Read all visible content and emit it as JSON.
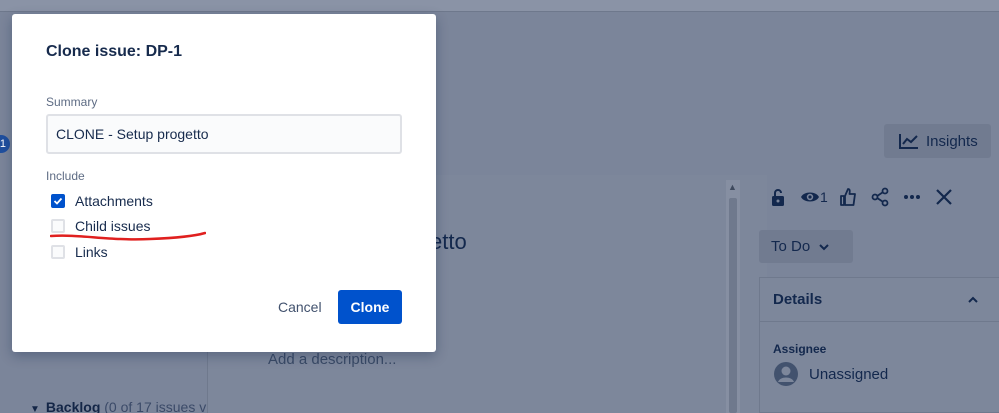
{
  "background": {
    "badge_count": "1",
    "issue_title_fragment": "etto",
    "description_placeholder": "Add a description...",
    "backlog_label": "Backlog",
    "backlog_count": "(0 of 17 issues v",
    "insights_label": "Insights",
    "watch_count": "1",
    "status_label": "To Do",
    "details_label": "Details",
    "assignee_label": "Assignee",
    "assignee_value": "Unassigned"
  },
  "modal": {
    "title": "Clone issue: DP-1",
    "summary_label": "Summary",
    "summary_value": "CLONE - Setup progetto",
    "include_label": "Include",
    "options": [
      {
        "label": "Attachments",
        "checked": true
      },
      {
        "label": "Child issues",
        "checked": false
      },
      {
        "label": "Links",
        "checked": false
      }
    ],
    "cancel_label": "Cancel",
    "clone_label": "Clone"
  },
  "colors": {
    "primary": "#0052cc",
    "overlay": "#7b859a",
    "annotation": "#e0201f"
  }
}
